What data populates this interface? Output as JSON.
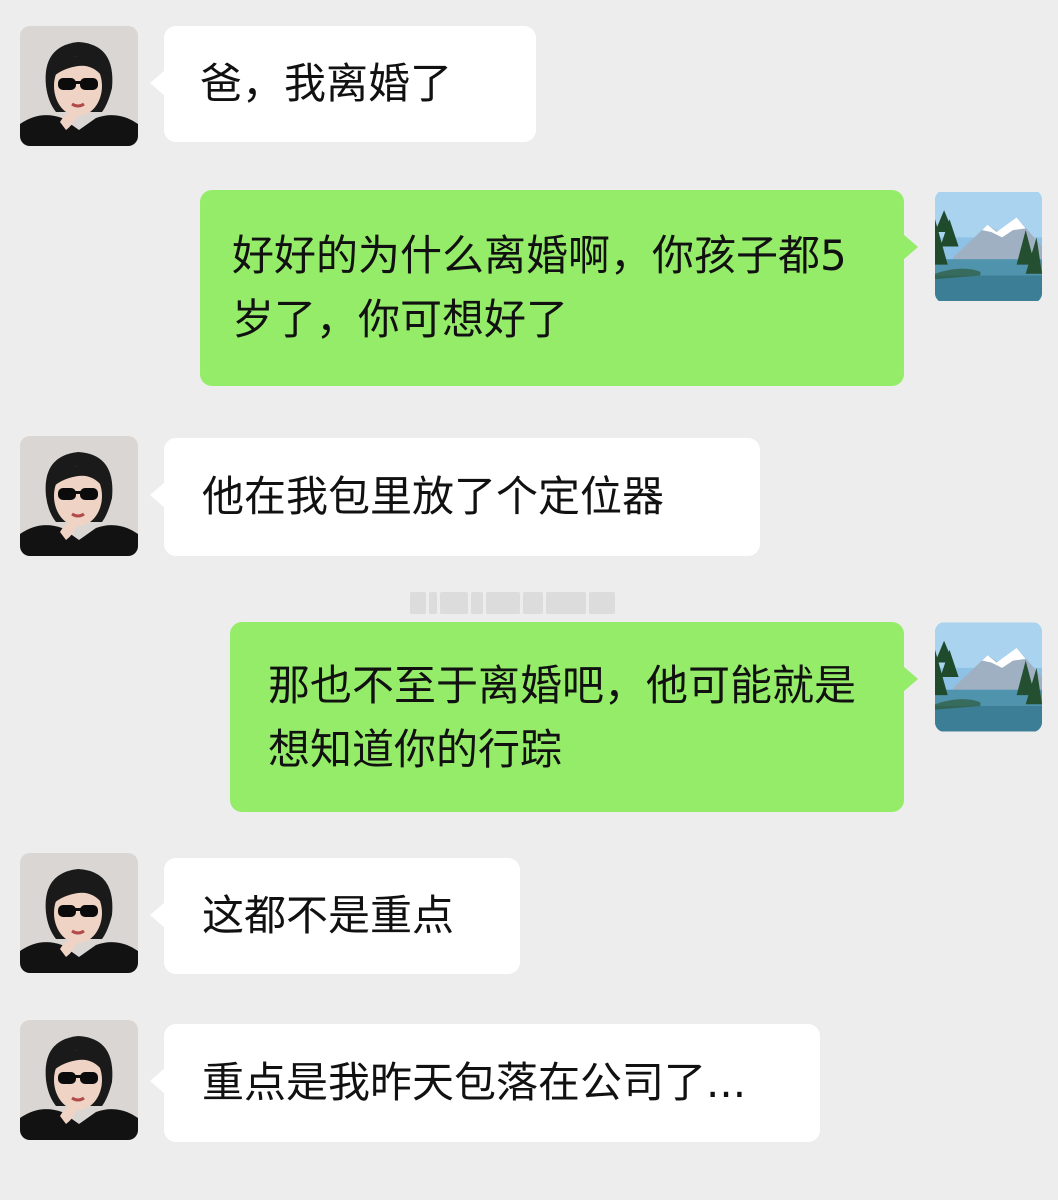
{
  "messages": [
    {
      "side": "left",
      "avatar": "woman-sunglasses-avatar",
      "text": "爸，我离婚了"
    },
    {
      "side": "right",
      "avatar": "mountain-lake-avatar",
      "text": "好好的为什么离婚啊，你孩子都5岁了，你可想好了"
    },
    {
      "side": "left",
      "avatar": "woman-sunglasses-avatar",
      "text": "他在我包里放了个定位器"
    },
    {
      "side": "right",
      "avatar": "mountain-lake-avatar",
      "text": "那也不至于离婚吧，他可能就是想知道你的行踪"
    },
    {
      "side": "left",
      "avatar": "woman-sunglasses-avatar",
      "text": "这都不是重点"
    },
    {
      "side": "left",
      "avatar": "woman-sunglasses-avatar",
      "text": "重点是我昨天包落在公司了..."
    }
  ],
  "colors": {
    "background": "#ededed",
    "incoming_bubble": "#ffffff",
    "outgoing_bubble": "#95ec69"
  }
}
